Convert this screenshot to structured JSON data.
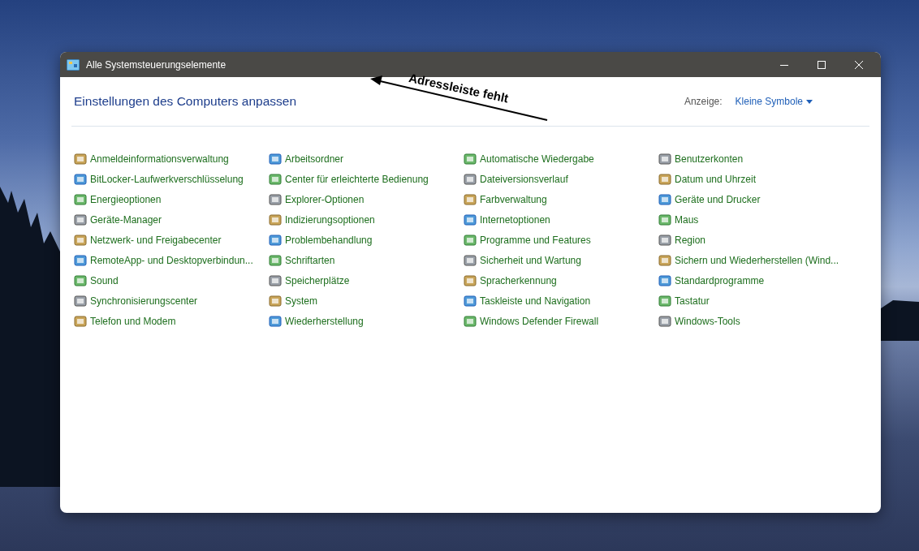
{
  "window": {
    "title": "Alle Systemsteuerungselemente"
  },
  "header": {
    "title": "Einstellungen des Computers anpassen",
    "view_label": "Anzeige:",
    "view_value": "Kleine Symbole"
  },
  "columns": [
    {
      "items": [
        "Anmeldeinformationsverwaltung",
        "BitLocker-Laufwerkverschlüsselung",
        "Energieoptionen",
        "Geräte-Manager",
        "Netzwerk- und Freigabecenter",
        "RemoteApp- und Desktopverbindun...",
        "Sound",
        "Synchronisierungscenter",
        "Telefon und Modem"
      ]
    },
    {
      "items": [
        "Arbeitsordner",
        "Center für erleichterte Bedienung",
        "Explorer-Optionen",
        "Indizierungsoptionen",
        "Problembehandlung",
        "Schriftarten",
        "Speicherplätze",
        "System",
        "Wiederherstellung"
      ]
    },
    {
      "items": [
        "Automatische Wiedergabe",
        "Dateiversionsverlauf",
        "Farbverwaltung",
        "Internetoptionen",
        "Programme und Features",
        "Sicherheit und Wartung",
        "Spracherkennung",
        "Taskleiste und Navigation",
        "Windows Defender Firewall"
      ]
    },
    {
      "items": [
        "Benutzerkonten",
        "Datum und Uhrzeit",
        "Geräte und Drucker",
        "Maus",
        "Region",
        "Sichern und Wiederherstellen (Wind...",
        "Standardprogramme",
        "Tastatur",
        "Windows-Tools"
      ]
    }
  ],
  "annotation": {
    "text": "Adressleiste fehlt"
  }
}
